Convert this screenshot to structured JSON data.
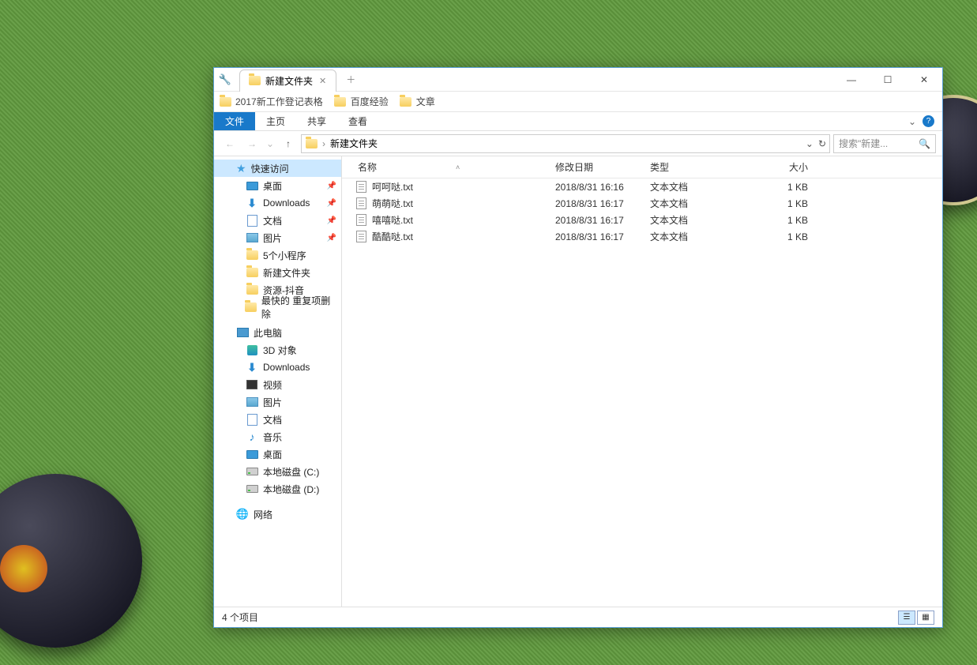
{
  "window": {
    "tab_title": "新建文件夹",
    "bookmarks": [
      {
        "label": "2017新工作登记表格"
      },
      {
        "label": "百度经验"
      },
      {
        "label": "文章"
      }
    ]
  },
  "ribbon": {
    "file": "文件",
    "tabs": [
      "主页",
      "共享",
      "查看"
    ]
  },
  "address": {
    "path": "新建文件夹",
    "search_placeholder": "搜索\"新建..."
  },
  "sidebar": {
    "quick_access": "快速访问",
    "pinned": [
      {
        "label": "桌面",
        "icon": "desktop"
      },
      {
        "label": "Downloads",
        "icon": "download"
      },
      {
        "label": "文档",
        "icon": "doc"
      },
      {
        "label": "图片",
        "icon": "pic"
      }
    ],
    "recent": [
      {
        "label": "5个小程序"
      },
      {
        "label": "新建文件夹"
      },
      {
        "label": "资源-抖音"
      },
      {
        "label": "最快的 重复项删除"
      }
    ],
    "this_pc": "此电脑",
    "pc_items": [
      {
        "label": "3D 对象",
        "icon": "3d"
      },
      {
        "label": "Downloads",
        "icon": "download"
      },
      {
        "label": "视频",
        "icon": "video"
      },
      {
        "label": "图片",
        "icon": "pic"
      },
      {
        "label": "文档",
        "icon": "doc"
      },
      {
        "label": "音乐",
        "icon": "music"
      },
      {
        "label": "桌面",
        "icon": "desktop"
      },
      {
        "label": "本地磁盘 (C:)",
        "icon": "drive"
      },
      {
        "label": "本地磁盘 (D:)",
        "icon": "drive"
      }
    ],
    "network": "网络"
  },
  "columns": {
    "name": "名称",
    "date": "修改日期",
    "type": "类型",
    "size": "大小"
  },
  "files": [
    {
      "name": "呵呵哒.txt",
      "date": "2018/8/31 16:16",
      "type": "文本文档",
      "size": "1 KB"
    },
    {
      "name": "萌萌哒.txt",
      "date": "2018/8/31 16:17",
      "type": "文本文档",
      "size": "1 KB"
    },
    {
      "name": "嘻嘻哒.txt",
      "date": "2018/8/31 16:17",
      "type": "文本文档",
      "size": "1 KB"
    },
    {
      "name": "酷酷哒.txt",
      "date": "2018/8/31 16:17",
      "type": "文本文档",
      "size": "1 KB"
    }
  ],
  "status": {
    "item_count": "4 个项目"
  }
}
